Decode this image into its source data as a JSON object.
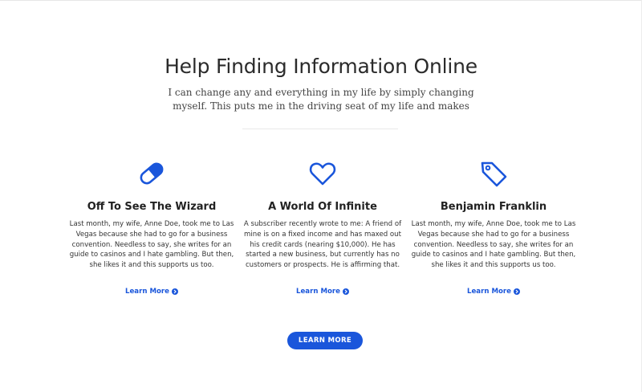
{
  "colors": {
    "accent": "#1a56db",
    "text": "#222222"
  },
  "header": {
    "title": "Help Finding Information Online",
    "subtitle": "I can change any and everything in my life by simply changing myself. This puts me in the driving seat of my life and makes"
  },
  "features": [
    {
      "icon": "pill-icon",
      "title": "Off To See The Wizard",
      "text": "Last month, my wife, Anne Doe, took me to Las Vegas because she had to go for a business convention. Needless to say, she writes for an guide to casinos and I hate gambling. But then, she likes it and this supports us too.",
      "link": "Learn More"
    },
    {
      "icon": "heart-icon",
      "title": "A World Of Infinite",
      "text": "A subscriber recently wrote to me: A friend of mine is on a fixed income and has maxed out his credit cards (nearing $10,000). He has started a new business, but currently has no customers or prospects. He is affirming that.",
      "link": "Learn More"
    },
    {
      "icon": "tag-icon",
      "title": "Benjamin Franklin",
      "text": "Last month, my wife, Anne Doe, took me to Las Vegas because she had to go for a business convention. Needless to say, she writes for an guide to casinos and I hate gambling. But then, she likes it and this supports us too.",
      "link": "Learn More"
    }
  ],
  "cta": {
    "label": "LEARN MORE"
  }
}
